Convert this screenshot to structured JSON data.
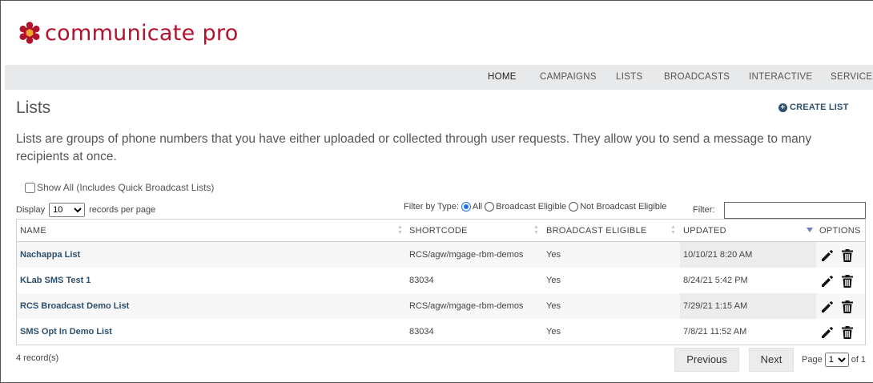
{
  "brand": {
    "name": "communicate pro",
    "logo_icon": "hexagon-flower-logo-icon",
    "color": "#b3122c"
  },
  "nav": {
    "items": [
      {
        "label": "HOME",
        "active": true
      },
      {
        "label": "CAMPAIGNS",
        "active": false
      },
      {
        "label": "LISTS",
        "active": false
      },
      {
        "label": "BROADCASTS",
        "active": false
      },
      {
        "label": "INTERACTIVE",
        "active": false
      },
      {
        "label": "SERVICES",
        "active": false
      }
    ]
  },
  "page": {
    "title": "Lists",
    "create_label": "CREATE LIST",
    "description": "Lists are groups of phone numbers that you have either uploaded or collected through user requests. They allow you to send a message to many recipients at once."
  },
  "controls": {
    "show_all_label": "Show All (Includes Quick Broadcast Lists)",
    "display_prefix": "Display",
    "display_value": "10",
    "display_suffix": "records per page",
    "filter_type_label": "Filter by Type:",
    "filter_options": [
      "All",
      "Broadcast Eligible",
      "Not Broadcast Eligible"
    ],
    "filter_selected": "All",
    "filter_label": "Filter:",
    "filter_value": ""
  },
  "table": {
    "columns": [
      "NAME",
      "SHORTCODE",
      "BROADCAST ELIGIBLE",
      "UPDATED",
      "OPTIONS"
    ],
    "sorted_column": "UPDATED",
    "sort_direction": "desc",
    "rows": [
      {
        "name": "Nachappa List",
        "shortcode": "RCS/agw/mgage-rbm-demos",
        "eligible": "Yes",
        "updated": "10/10/21 8:20 AM"
      },
      {
        "name": "KLab SMS Test 1",
        "shortcode": "83034",
        "eligible": "Yes",
        "updated": "8/24/21 5:42 PM"
      },
      {
        "name": "RCS Broadcast Demo List",
        "shortcode": "RCS/agw/mgage-rbm-demos",
        "eligible": "Yes",
        "updated": "7/29/21 1:15 AM"
      },
      {
        "name": "SMS Opt In Demo List",
        "shortcode": "83034",
        "eligible": "Yes",
        "updated": "7/8/21 11:52 AM"
      }
    ]
  },
  "footer": {
    "records": "4 record(s)",
    "previous_label": "Previous",
    "next_label": "Next",
    "page_label": "Page",
    "page_value": "1",
    "of_label": "of 1"
  }
}
